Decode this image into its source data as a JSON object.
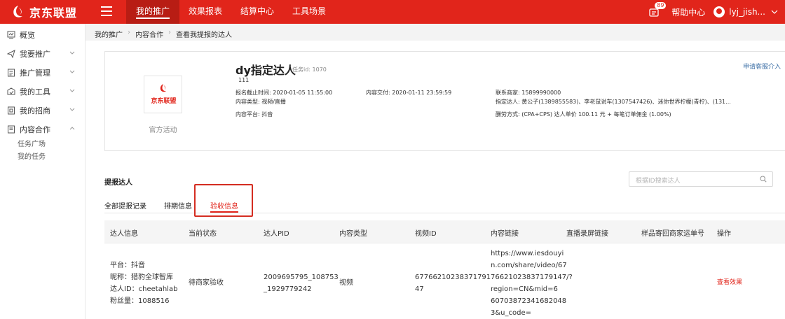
{
  "brand": {
    "name": "京东联盟",
    "color": "#e1251b"
  },
  "topnav": {
    "items": [
      {
        "label": "我的推广",
        "active": true
      },
      {
        "label": "效果报表"
      },
      {
        "label": "结算中心"
      },
      {
        "label": "工具场景"
      }
    ]
  },
  "topright": {
    "message_count": "89",
    "help": "帮助中心",
    "username": "lyj_jish..."
  },
  "sidebar": {
    "items": [
      {
        "label": "概览",
        "icon": "overview-icon"
      },
      {
        "label": "我要推广",
        "icon": "send-icon"
      },
      {
        "label": "推广管理",
        "icon": "manage-icon"
      },
      {
        "label": "我的工具",
        "icon": "tool-icon"
      },
      {
        "label": "我的招商",
        "icon": "merchant-icon"
      },
      {
        "label": "内容合作",
        "icon": "content-icon"
      }
    ],
    "sub_items": [
      "任务广场",
      "我的任务"
    ]
  },
  "breadcrumb": [
    "我的推广",
    "内容合作",
    "查看我提报的达人"
  ],
  "task": {
    "apply_link": "申请客服介入",
    "logo_text": "京东联盟",
    "official": "官方活动",
    "title": "dy指定达人",
    "task_id": "任务id: 1070",
    "desc": "111",
    "deadline": "报名截止时间: 2020-01-05 11:55:00",
    "content_type": "内容类型: 视频/直播",
    "platform": "内容平台: 抖音",
    "delivery": "内容交付: 2020-01-11 23:59:59",
    "contact": "联系商家: 15899990000",
    "designated": "指定达人: 黄公子(1389855583)、李老鼠说车(1307547426)、迷你世界柠檬(青柠)、(131...",
    "commission": "酬劳方式: (CPA+CPS) 达人单价 100.11 元 + 每笔订单佣金 (1.00%)"
  },
  "section": {
    "title": "提报达人",
    "search_placeholder": "根据ID搜索达人"
  },
  "tabs": [
    {
      "label": "全部提报记录"
    },
    {
      "label": "排期信息"
    },
    {
      "label": "验收信息",
      "active": true
    }
  ],
  "table": {
    "headers": [
      "达人信息",
      "当前状态",
      "达人PID",
      "内容类型",
      "视频ID",
      "内容链接",
      "直播录屏链接",
      "样品寄回商家运单号",
      "操作"
    ],
    "row": {
      "info": [
        "平台：抖音",
        "昵称：猎豹全球智库",
        "达人ID：cheetahlab",
        "粉丝量：1088516"
      ],
      "status": "待商家验收",
      "pid": [
        "2009695795_108753",
        "_1929779242"
      ],
      "content_type": "视频",
      "video_id": [
        "67766210238371791",
        "47"
      ],
      "link": [
        "https://www.iesdouyi",
        "n.com/share/video/67",
        "76621023837179147/?",
        "region=CN&mid=6",
        "60703872341682048",
        "3&u_code="
      ],
      "action": "查看效果"
    }
  }
}
